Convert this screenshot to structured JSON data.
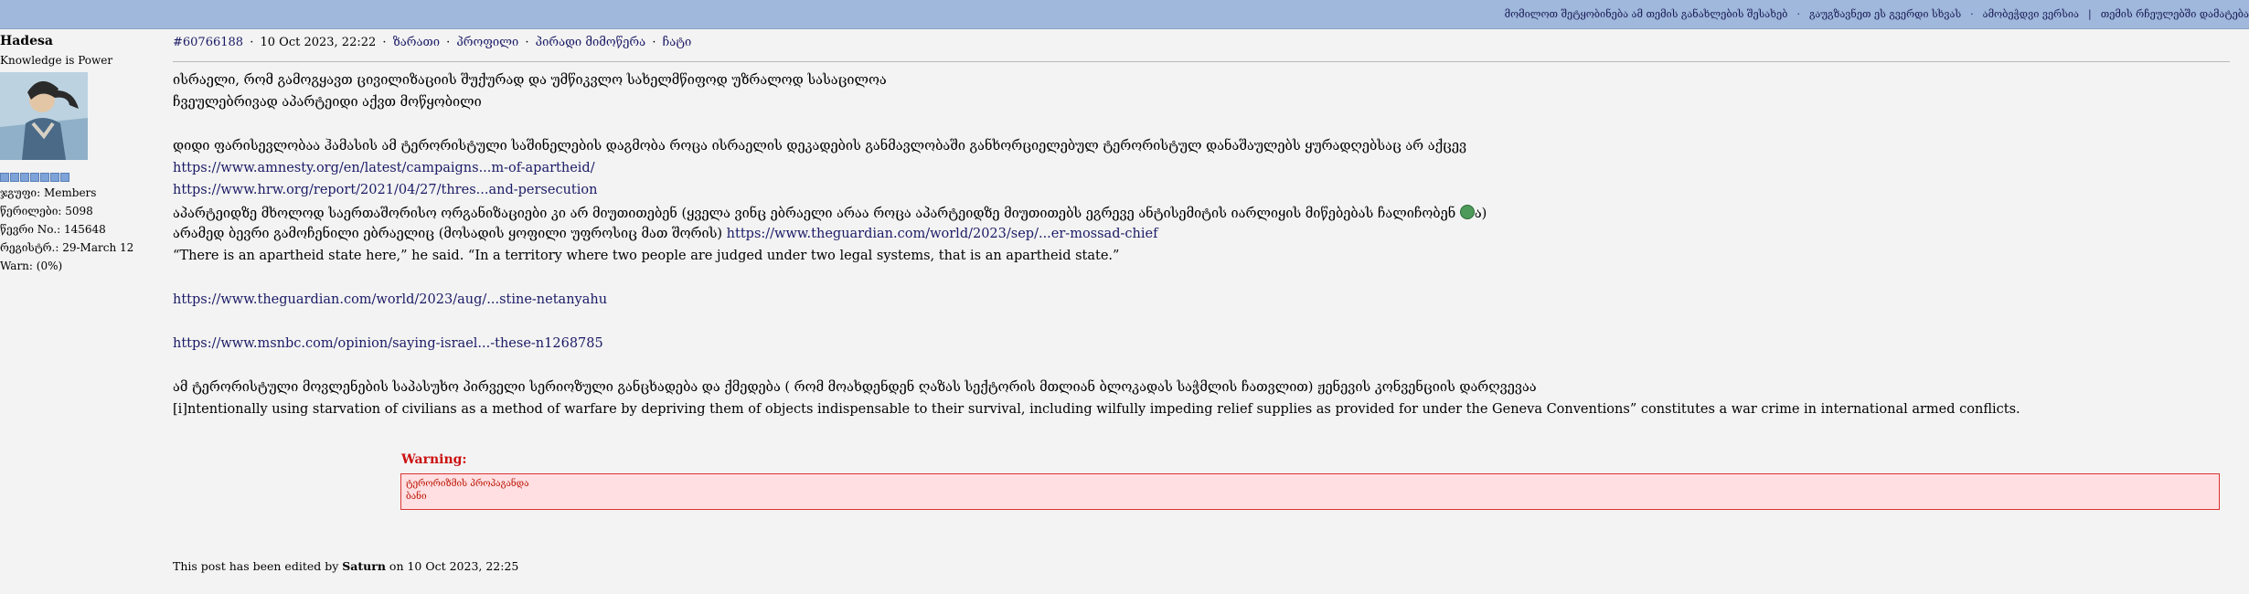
{
  "topbar": {
    "links": [
      "მომილოთ შეტყობინება ამ თემის განახლების შესახებ",
      "გაუგზავნეთ ეს გვერდი სხვას",
      "ამობეჭდვი ვერსია",
      "თემის რჩეულებში დამატება"
    ]
  },
  "user": {
    "name": "Hadesa",
    "title": "Knowledge is Power",
    "group": "ჯგუფი: Members",
    "posts": "წერილები: 5098",
    "number": "წევრი No.: 145648",
    "registered": "რეგისტრ.: 29-March 12",
    "warn": "Warn: (0%)"
  },
  "post": {
    "id": "#60766188",
    "date": "10 Oct 2023, 22:22",
    "actions": [
      "ზარათი",
      "პროფილი",
      "პირადი მიმოწერა",
      "ჩატი"
    ],
    "lines": [
      "ისრაელი, რომ გამოგყავთ ცივილიზაციის შუქურად და უმწიკვლო სახელმწიფოდ უზრალოდ სასაცილოა",
      "ჩვეულებრივად აპარტეიდი აქვთ მოწყობილი",
      "დიდი ფარისევლობაა ჰამასის ამ ტერორისტული საშინელების დაგმობა როცა ისრაელის დეკადების განმავლობაში განხორციელებულ ტერორისტულ დანაშაულებს ყურადღებსაც არ აქცევ",
      "https://www.amnesty.org/en/latest/campaigns...m-of-apartheid/",
      "https://www.hrw.org/report/2021/04/27/thres...and-persecution",
      "აპარტეიდზე მხოლოდ საერთაშორისო ორგანიზაციები კი არ მიუთითებენ (ყველა ვინც ებრაელი არაა როცა აპარტეიდზე მიუთითებს ეგრევე ანტისემიტის იარლიყის მიწებებას ჩალიჩობენ",
      "ა)",
      "არამედ ბევრი გამოჩენილი ებრაელიც (მოსადის ყოფილი უფროსიც მათ შორის)",
      "https://www.theguardian.com/world/2023/sep/...er-mossad-chief",
      "“There is an apartheid state here,” he said. “In a territory where two people are judged under two legal systems, that is an apartheid state.”",
      "https://www.theguardian.com/world/2023/aug/...stine-netanyahu",
      "https://www.msnbc.com/opinion/saying-israel...-these-n1268785",
      "ამ ტერორისტული მოვლენების საპასუხო პირველი სერიოზული განცხადება და ქმედება ( რომ მოახდენდენ ღაზას სექტორის მთლიან ბლოკადას საჭმლის ჩათვლით) ჟენევის კონვენციის დარღვევაა",
      "[i]ntentionally using starvation of civilians as a method of warfare by depriving them of objects indispensable to their survival, including wilfully impeding relief supplies as provided for under the Geneva Conventions” constitutes a war crime in international armed conflicts."
    ],
    "warning": {
      "title": "Warning:",
      "line1": "ტერორიზმის პროპაგანდა",
      "line2": "ბანი"
    },
    "edit": {
      "prefix": "This post has been edited by",
      "editor": "Saturn",
      "suffix": "on 10 Oct 2023, 22:25"
    }
  }
}
